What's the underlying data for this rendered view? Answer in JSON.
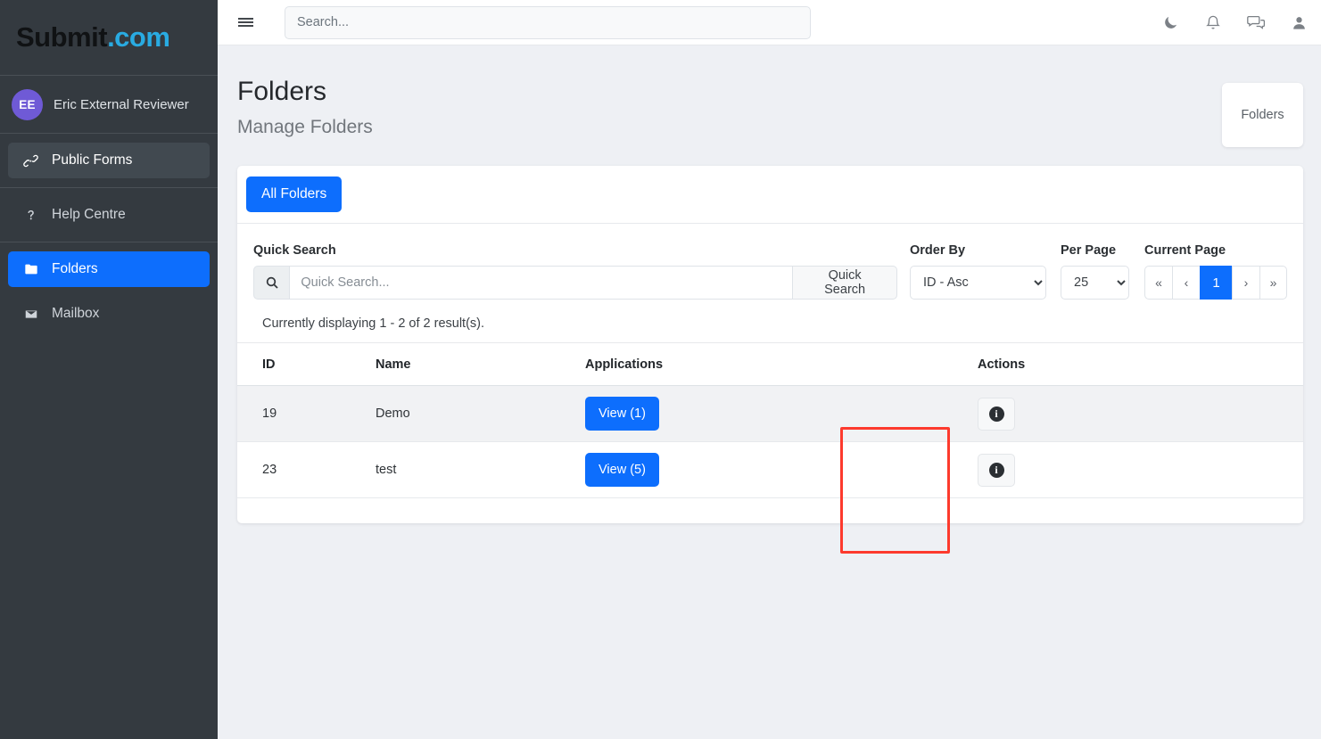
{
  "brand": {
    "name": "Submit",
    "suffix": ".com"
  },
  "sidebar": {
    "user": {
      "initials": "EE",
      "name": "Eric External Reviewer"
    },
    "items": [
      {
        "label": "Public Forms",
        "icon": "link-icon",
        "state": "hover"
      },
      {
        "label": "Help Centre",
        "icon": "question-mark-icon",
        "state": "normal"
      },
      {
        "label": "Folders",
        "icon": "folder-icon",
        "state": "active"
      },
      {
        "label": "Mailbox",
        "icon": "envelope-icon",
        "state": "normal"
      }
    ]
  },
  "topbar": {
    "menu_icon": "hamburger-icon",
    "search_placeholder": "Search...",
    "search_value": "",
    "icons": [
      "moon-icon",
      "bell-icon",
      "chat-icon",
      "user-icon"
    ]
  },
  "page": {
    "title": "Folders",
    "subtitle": "Manage Folders",
    "breadcrumb": "Folders"
  },
  "card": {
    "tab_label": "All Folders",
    "filters": {
      "quick_search_label": "Quick Search",
      "quick_search_placeholder": "Quick Search...",
      "quick_search_value": "",
      "quick_search_button": "Quick Search",
      "order_by_label": "Order By",
      "order_by_value": "ID - Asc",
      "order_by_options": [
        "ID - Asc"
      ],
      "per_page_label": "Per Page",
      "per_page_value": "25",
      "per_page_options": [
        "25"
      ],
      "current_page_label": "Current Page",
      "pagination": [
        {
          "label": "«",
          "name": "first-page",
          "active": false
        },
        {
          "label": "‹",
          "name": "prev-page",
          "active": false
        },
        {
          "label": "1",
          "name": "page-1",
          "active": true
        },
        {
          "label": "›",
          "name": "next-page",
          "active": false
        },
        {
          "label": "»",
          "name": "last-page",
          "active": false
        }
      ]
    },
    "result_count": "Currently displaying 1 - 2 of 2 result(s).",
    "table": {
      "headers": [
        "ID",
        "Name",
        "Applications",
        "Actions"
      ],
      "rows": [
        {
          "id": "19",
          "name": "Demo",
          "applications": "View (1)",
          "action_icon": "info-icon",
          "action_glyph": "i"
        },
        {
          "id": "23",
          "name": "test",
          "applications": "View (5)",
          "action_icon": "info-icon",
          "action_glyph": "i"
        }
      ]
    }
  },
  "annotation": {
    "color": "#fd3a2d",
    "target": "applications-view-buttons"
  },
  "colors": {
    "accent_blue": "#0d6efd",
    "sidebar_bg": "#343a40",
    "page_bg": "#eef0f4",
    "avatar_purple": "#6f5ad6",
    "brand_cyan": "#29abe2",
    "annotation_red": "#fd3a2d"
  }
}
